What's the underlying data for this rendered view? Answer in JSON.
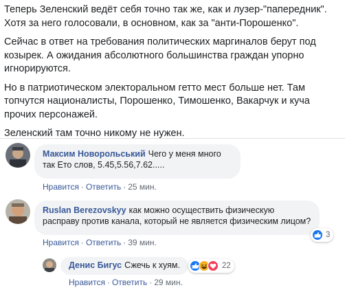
{
  "post": {
    "paragraphs": [
      "Теперь Зеленский ведёт себя точно так же, как и лузер-\"папередник\". Хотя за него голосовали, в основном, как за \"анти-Порошенко\".",
      "Сейчас в ответ на требования политических маргиналов берут под козырек. А ожидания абсолютного большинства граждан упорно игнорируются.",
      "Но в патриотическом электоральном гетто мест больше нет. Там топчутся националисты, Порошенко, Тимошенко, Вакарчук и куча прочих персонажей.",
      "Зеленский там точно никому не нужен."
    ]
  },
  "actions": {
    "like": "Нравится",
    "reply": "Ответить",
    "separator": "·"
  },
  "comments": [
    {
      "author": "Максим Новорольський",
      "text": "Чего у меня много так Ето слов, 5.45,5.56,7.62.....",
      "time": "25 мин."
    },
    {
      "author": "Ruslan Berezovskyy",
      "text": "как можно осуществить физическую расправу против канала, который не является физическим лицом?",
      "time": "39 мин.",
      "reaction_count": "3"
    },
    {
      "author": "Денис Бигус",
      "text": "Сжечь к хуям.",
      "time": "29 мин.",
      "reaction_count": "22"
    }
  ],
  "colors": {
    "link": "#385898",
    "bubble": "#f2f3f5",
    "like_blue": "#1877f2",
    "love_red": "#f33e58",
    "haha_yellow": "#f7b125"
  },
  "icons": [
    "like-reaction-icon",
    "love-reaction-icon",
    "haha-reaction-icon"
  ]
}
